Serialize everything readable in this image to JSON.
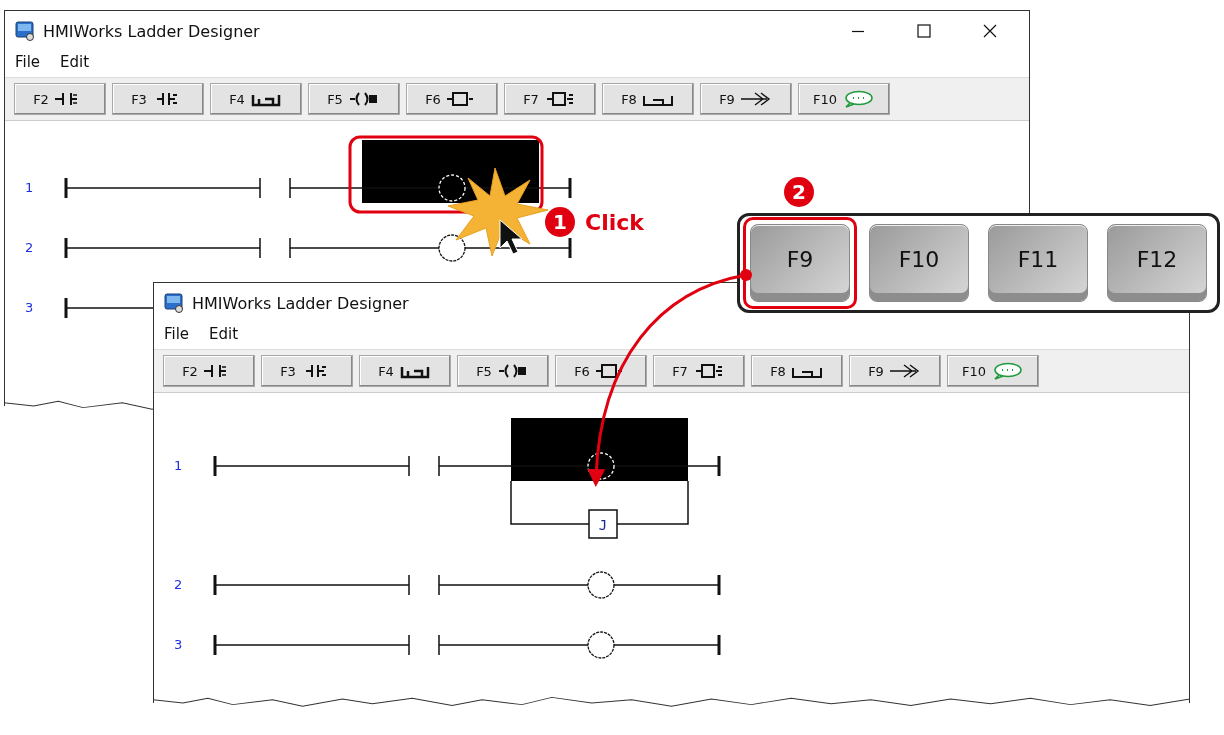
{
  "windows": [
    {
      "title": "HMIWorks Ladder Designer",
      "window_buttons": true,
      "menu": [
        "File",
        "Edit"
      ],
      "toolbar": [
        {
          "label": "F2",
          "kind": "contact_no"
        },
        {
          "label": "F3",
          "kind": "contact_nc"
        },
        {
          "label": "F4",
          "kind": "branch"
        },
        {
          "label": "F5",
          "kind": "coil"
        },
        {
          "label": "F6",
          "kind": "func"
        },
        {
          "label": "F7",
          "kind": "func_not"
        },
        {
          "label": "F8",
          "kind": "set"
        },
        {
          "label": "F9",
          "kind": "jump"
        },
        {
          "label": "F10",
          "kind": "comment"
        }
      ],
      "rungs": [
        {
          "number": "1",
          "selected": true
        },
        {
          "number": "2",
          "selected": false
        },
        {
          "number": "3"
        }
      ]
    },
    {
      "title": "HMIWorks Ladder Designer",
      "window_buttons": false,
      "menu": [
        "File",
        "Edit"
      ],
      "toolbar": [
        {
          "label": "F2",
          "kind": "contact_no"
        },
        {
          "label": "F3",
          "kind": "contact_nc"
        },
        {
          "label": "F4",
          "kind": "branch"
        },
        {
          "label": "F5",
          "kind": "coil"
        },
        {
          "label": "F6",
          "kind": "func"
        },
        {
          "label": "F7",
          "kind": "func_not"
        },
        {
          "label": "F8",
          "kind": "set"
        },
        {
          "label": "F9",
          "kind": "jump"
        },
        {
          "label": "F10",
          "kind": "comment"
        }
      ],
      "rungs": [
        {
          "number": "1",
          "selected": true,
          "branch": "J"
        },
        {
          "number": "2",
          "selected": false
        },
        {
          "number": "3",
          "selected": false
        }
      ]
    }
  ],
  "steps": [
    {
      "number": "1",
      "label": "Click"
    },
    {
      "number": "2"
    }
  ],
  "keys": [
    {
      "label": "F9",
      "selected": true
    },
    {
      "label": "F10",
      "selected": false
    },
    {
      "label": "F11",
      "selected": false
    },
    {
      "label": "F12",
      "selected": false
    }
  ]
}
